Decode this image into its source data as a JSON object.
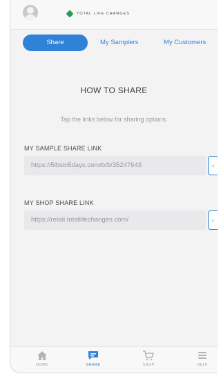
{
  "header": {
    "brand": "TOTAL LIFE CHANGES"
  },
  "tabs": [
    {
      "label": "Share"
    },
    {
      "label": "My Samplers"
    },
    {
      "label": "My Customers"
    }
  ],
  "how_to": {
    "title": "HOW TO SHARE",
    "subtitle": "Tap the links below for sharing options."
  },
  "sample_link": {
    "label": "MY SAMPLE SHARE LINK",
    "value": "https://5lbsin5days.com/b/b/35247643"
  },
  "shop_link": {
    "label": "MY SHOP SHARE LINK",
    "value": "https://retail.totallifechanges.com/"
  },
  "bottom_nav": [
    {
      "label": "HOME",
      "icon": "home-icon"
    },
    {
      "label": "SHARE",
      "icon": "chat-icon"
    },
    {
      "label": "SHOP",
      "icon": "cart-icon"
    },
    {
      "label": "HELP",
      "icon": "help-icon"
    }
  ],
  "colors": {
    "accent": "#2f82d8",
    "brand_green": "#2e9a5a",
    "background": "#f3f3f4"
  }
}
